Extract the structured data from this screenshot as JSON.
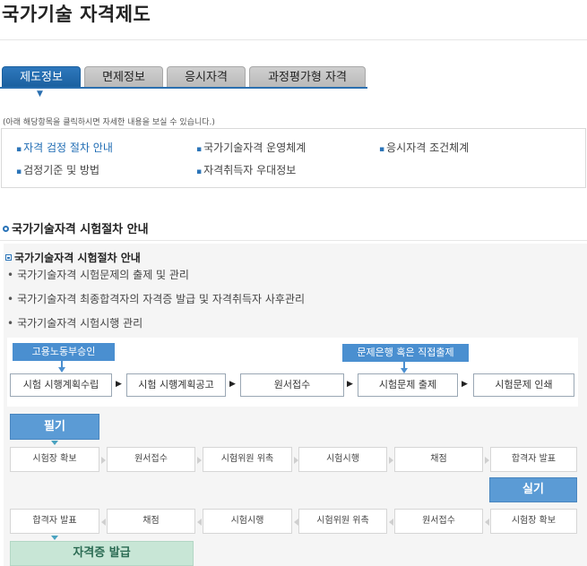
{
  "page_title": "국가기술 자격제도",
  "tabs": [
    {
      "label": "제도정보",
      "active": true
    },
    {
      "label": "면제정보",
      "active": false
    },
    {
      "label": "응시자격",
      "active": false
    },
    {
      "label": "과정평가형 자격",
      "active": false
    }
  ],
  "hint": "(아래 해당항목을 클릭하시면 자세한 내용을 보실 수 있습니다.)",
  "menu": [
    {
      "label": "자격 검정 절차 안내",
      "selected": true
    },
    {
      "label": "국가기술자격 운영체계",
      "selected": false
    },
    {
      "label": "응시자격 조건체계",
      "selected": false
    },
    {
      "label": "검정기준 및 방법",
      "selected": false
    },
    {
      "label": "자격취득자 우대정보",
      "selected": false
    }
  ],
  "section_title": "국가기술자격 시험절차 안내",
  "sub_title": "국가기술자격 시험절차 안내",
  "bullets": [
    "국가기술자격 시험문제의 출제 및 관리",
    "국가기술자격 최종합격자의 자격증 발급 및 자격취득자 사후관리",
    "국가기술자격 시험시행 관리"
  ],
  "flow": {
    "tag_left": "고용노동부승인",
    "tag_right": "문제은행 혹은 직접출제",
    "steps": [
      "시험 시행계획수립",
      "시험 시행계획공고",
      "원서접수",
      "시험문제 출제",
      "시험문제 인쇄"
    ],
    "arrow_glyph": "▶"
  },
  "written": {
    "label": "필기",
    "steps": [
      "시험장 확보",
      "원서접수",
      "시험위원 위촉",
      "시험시행",
      "채점",
      "합격자 발표"
    ]
  },
  "practical": {
    "label": "실기",
    "steps": [
      "합격자 발표",
      "채점",
      "시험시행",
      "시험위원 위촉",
      "원서접수",
      "시험장 확보"
    ]
  },
  "certificate": "자격증 발급",
  "colors": {
    "accent": "#2a6fb0",
    "tag_blue": "#4a8fd0",
    "green_tag": "#c8e6d6"
  }
}
